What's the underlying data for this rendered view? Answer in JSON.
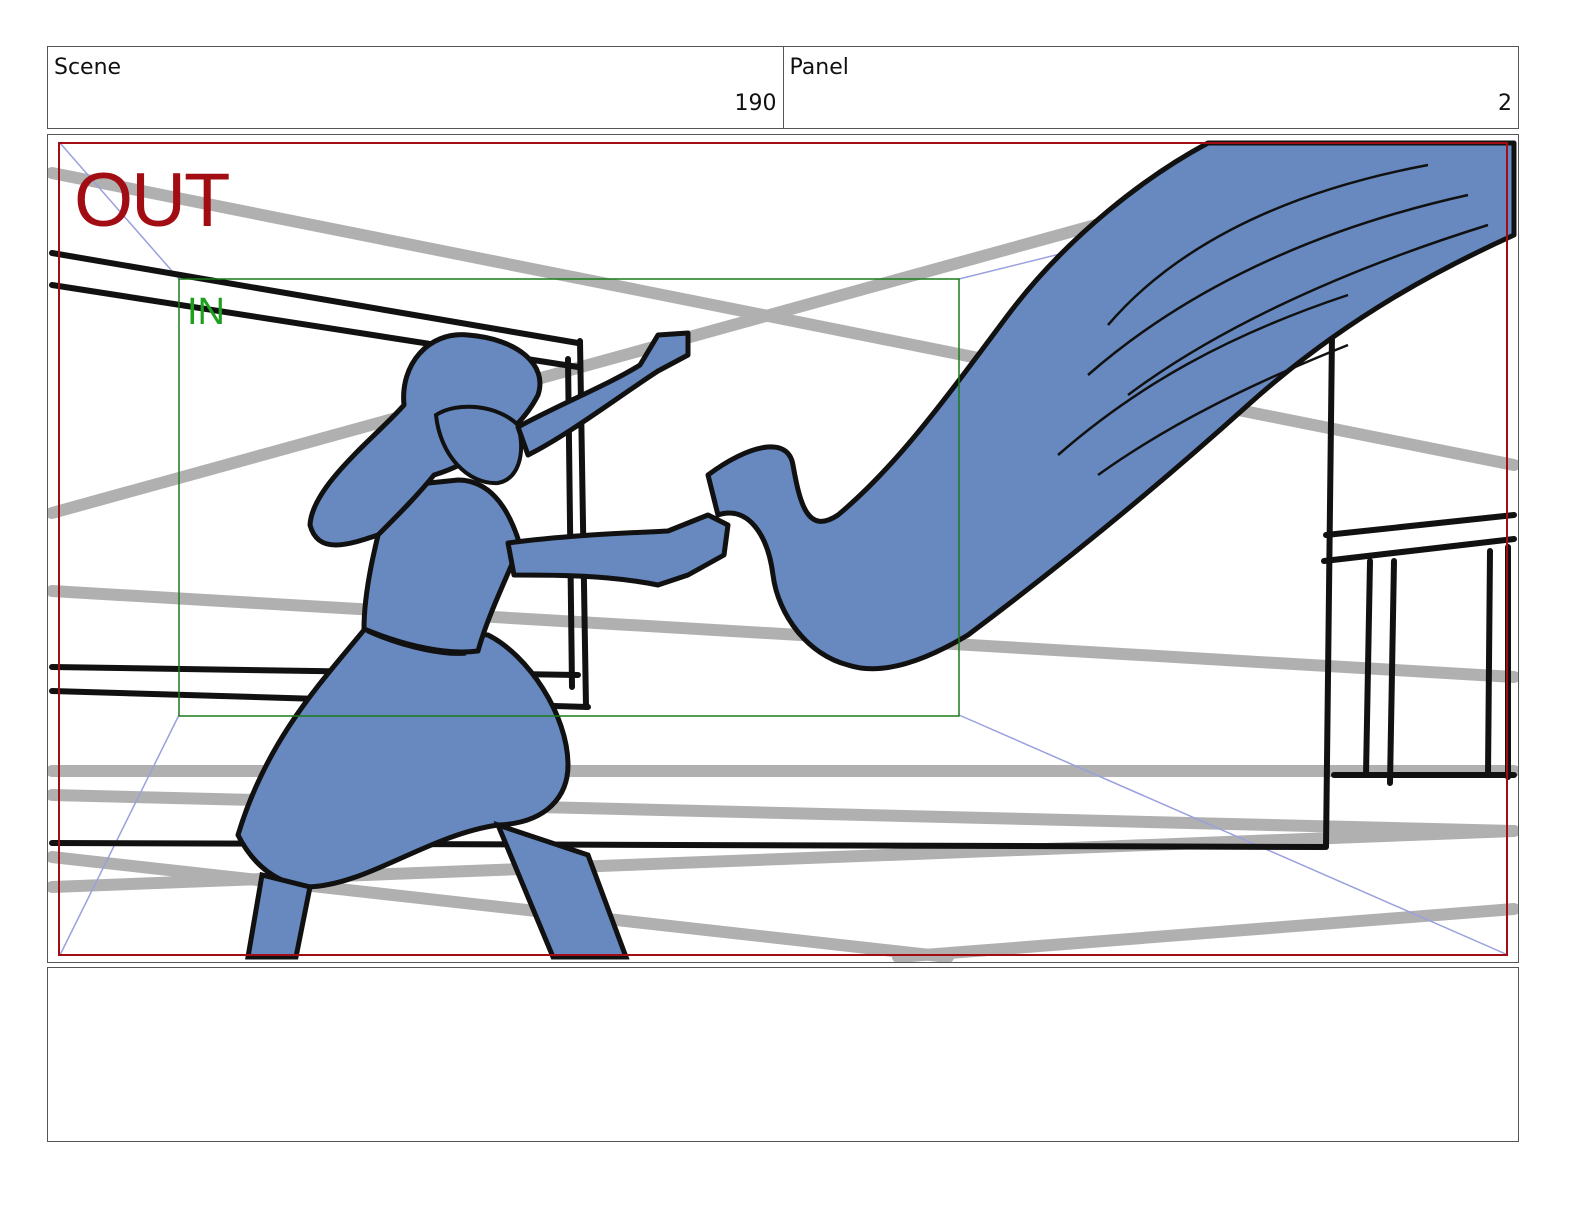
{
  "header": {
    "scene_label": "Scene",
    "scene_value": "190",
    "panel_label": "Panel",
    "panel_value": "2"
  },
  "frame": {
    "out_label": "OUT",
    "in_label": "IN"
  },
  "colors": {
    "out_frame": "#a10d12",
    "in_frame": "#1a7a1a",
    "in_text": "#1ea01e",
    "fill_blue": "#6789bf",
    "perspective_lines": "#b0b0b0",
    "guide_lines": "#9aa0dd"
  },
  "notes": {
    "text": ""
  }
}
